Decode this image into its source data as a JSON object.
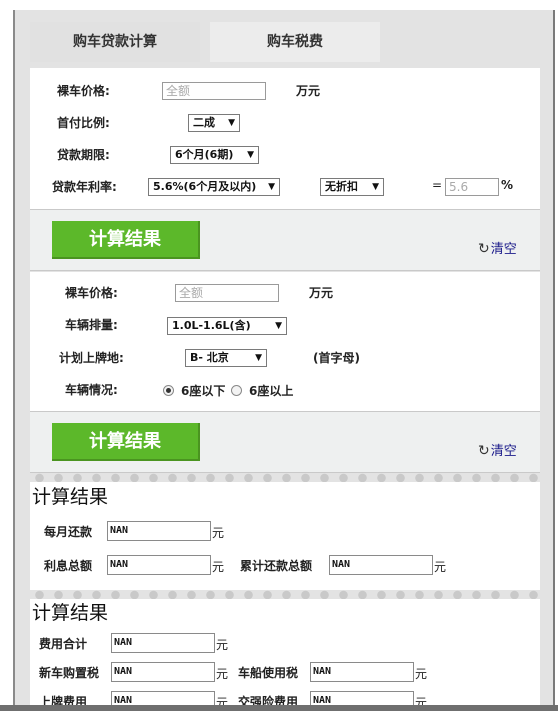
{
  "tabs": {
    "loan": "购车贷款计算",
    "tax": "购车税费"
  },
  "loan_form": {
    "price_label": "裸车价格:",
    "price_placeholder": "全额",
    "price_unit": "万元",
    "down_label": "首付比例:",
    "down_value": "二成",
    "term_label": "贷款期限:",
    "term_value": "6个月(6期)",
    "rate_label": "贷款年利率:",
    "rate_value": "5.6%(6个月及以内)",
    "discount_value": "无折扣",
    "equals": "=",
    "rate_result": "5.6",
    "percent": "%"
  },
  "actions": {
    "calc_label": "计算结果",
    "clear_label": "清空"
  },
  "tax_form": {
    "price_label": "裸车价格:",
    "price_placeholder": "全额",
    "price_unit": "万元",
    "displacement_label": "车辆排量:",
    "displacement_value": "1.0L-1.6L(含)",
    "plate_label": "计划上牌地:",
    "plate_value": "B- 北京",
    "plate_hint": "(首字母)",
    "seats_label": "车辆情况:",
    "seats_under6": "6座以下",
    "seats_over6": "6座以上"
  },
  "loan_result": {
    "title": "计算结果",
    "monthly_label": "每月还款",
    "monthly_value": "NAN",
    "interest_label": "利息总额",
    "interest_value": "NAN",
    "total_label": "累计还款总额",
    "total_value": "NAN",
    "unit": "元"
  },
  "tax_result": {
    "title": "计算结果",
    "fee_total_label": "费用合计",
    "fee_total_value": "NAN",
    "purchase_tax_label": "新车购置税",
    "purchase_tax_value": "NAN",
    "vessel_tax_label": "车船使用税",
    "vessel_tax_value": "NAN",
    "plate_fee_label": "上牌费用",
    "plate_fee_value": "NAN",
    "insurance_label": "交强险费用",
    "insurance_value": "NAN",
    "unit": "元"
  },
  "colors": {
    "button_green": "#5cb82a",
    "clear_link": "#1a1a8a"
  }
}
